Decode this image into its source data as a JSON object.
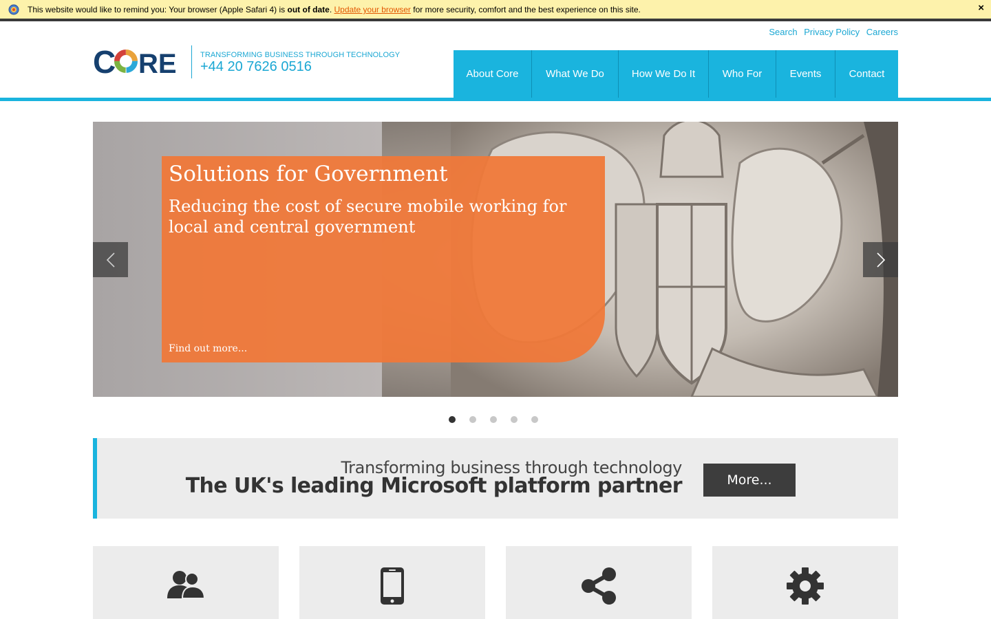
{
  "browser_notice": {
    "prefix": "This website would like to remind you: Your browser (Apple Safari 4) is ",
    "bold": "out of date",
    "period": ". ",
    "link": "Update your browser",
    "suffix": " for more security, comfort and the best experience on this site.",
    "close": "×"
  },
  "utility_links": [
    "Search",
    "Privacy Policy",
    "Careers"
  ],
  "brand": {
    "name": "CORE",
    "tagline": "TRANSFORMING BUSINESS THROUGH TECHNOLOGY",
    "phone": "+44 20 7626 0516"
  },
  "nav": [
    "About Core",
    "What We Do",
    "How We Do It",
    "Who For",
    "Events",
    "Contact"
  ],
  "hero": {
    "title": "Solutions for Government",
    "subtitle": "Reducing the cost of secure mobile working for local and central government",
    "link": "Find out more...",
    "slide_count": 5,
    "active_slide": 1
  },
  "promo": {
    "subheading": "Transforming business through technology",
    "headline": "The UK's leading Microsoft platform partner",
    "button": "More..."
  },
  "tiles": [
    {
      "icon": "people-icon"
    },
    {
      "icon": "mobile-phone-icon"
    },
    {
      "icon": "share-icon"
    },
    {
      "icon": "gear-icon"
    }
  ],
  "colors": {
    "accent": "#1ab4de",
    "hero_caption": "#f07838",
    "notice_bg": "#fdf2ab",
    "link_orange": "#e25600",
    "button_dark": "#3d3d3d"
  }
}
